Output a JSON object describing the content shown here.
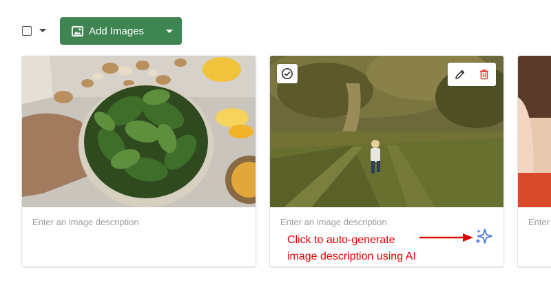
{
  "toolbar": {
    "add_images_label": "Add Images"
  },
  "cards": [
    {
      "description_placeholder": "Enter an image description"
    },
    {
      "description_placeholder": "Enter an image description"
    },
    {
      "description_placeholder": "Enter an image description"
    }
  ],
  "annotation": {
    "line1": "Click to auto-generate",
    "line2": "image description using AI",
    "color": "#e00000"
  },
  "colors": {
    "primary_button": "#3e8552",
    "sparkle": "#4a78e0",
    "delete": "#e53935"
  },
  "icons": [
    "image-icon",
    "check-circle-icon",
    "pencil-icon",
    "trash-icon",
    "sparkle-icon"
  ]
}
